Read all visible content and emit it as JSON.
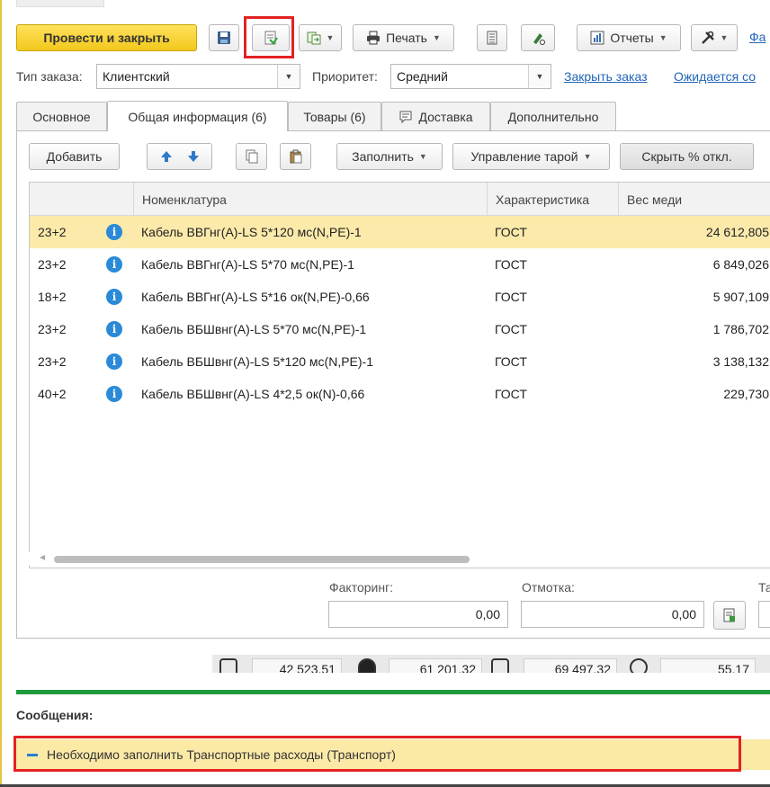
{
  "toolbar": {
    "post_close_label": "Провести и закрыть",
    "print_label": "Печать",
    "reports_label": "Отчеты",
    "more_link": "Фа"
  },
  "order": {
    "type_label": "Тип заказа:",
    "type_value": "Клиентский",
    "priority_label": "Приоритет:",
    "priority_value": "Средний",
    "close_order_link": "Закрыть заказ",
    "expected_link": "Ожидается со"
  },
  "tabs": [
    {
      "label": "Основное"
    },
    {
      "label": "Общая информация (6)"
    },
    {
      "label": "Товары (6)"
    },
    {
      "label": "Доставка"
    },
    {
      "label": "Дополнительно"
    }
  ],
  "grid_toolbar": {
    "add_label": "Добавить",
    "fill_label": "Заполнить",
    "packaging_label": "Управление тарой",
    "hide_label": "Скрыть % откл."
  },
  "table": {
    "columns": [
      "Номенклатура",
      "Характеристика",
      "Вес меди"
    ],
    "rows": [
      {
        "code": "23+2",
        "name": "Кабель ВВГнг(А)-LS 5*120 мс(N,PE)-1",
        "char": "ГОСТ",
        "weight": "24 612,805"
      },
      {
        "code": "23+2",
        "name": "Кабель ВВГнг(А)-LS 5*70 мс(N,PE)-1",
        "char": "ГОСТ",
        "weight": "6 849,026"
      },
      {
        "code": "18+2",
        "name": "Кабель ВВГнг(А)-LS 5*16 ок(N,PE)-0,66",
        "char": "ГОСТ",
        "weight": "5 907,109"
      },
      {
        "code": "23+2",
        "name": "Кабель ВБШвнг(А)-LS 5*70 мс(N,PE)-1",
        "char": "ГОСТ",
        "weight": "1 786,702"
      },
      {
        "code": "23+2",
        "name": "Кабель ВБШвнг(А)-LS 5*120 мс(N,PE)-1",
        "char": "ГОСТ",
        "weight": "3 138,132"
      },
      {
        "code": "40+2",
        "name": "Кабель ВБШвнг(А)-LS 4*2,5 ок(N)-0,66",
        "char": "ГОСТ",
        "weight": "229,730"
      }
    ]
  },
  "footer": {
    "factoring_label": "Факторинг:",
    "factoring_value": "0,00",
    "unwind_label": "Отмотка:",
    "unwind_value": "0,00",
    "third_label": "Та"
  },
  "totals": [
    "42 523,51",
    "61 201,32",
    "69 497,32",
    "55,17"
  ],
  "messages": {
    "title": "Сообщения:",
    "item": "Необходимо заполнить Транспортные расходы (Транспорт)"
  },
  "colors": {
    "primary_button": "#f2c81c",
    "selected_row": "#fbeaaa",
    "highlight_frame": "#e32222",
    "link": "#2365b8",
    "message_bg": "#fbe9a6",
    "divider": "#1e9b3a"
  }
}
